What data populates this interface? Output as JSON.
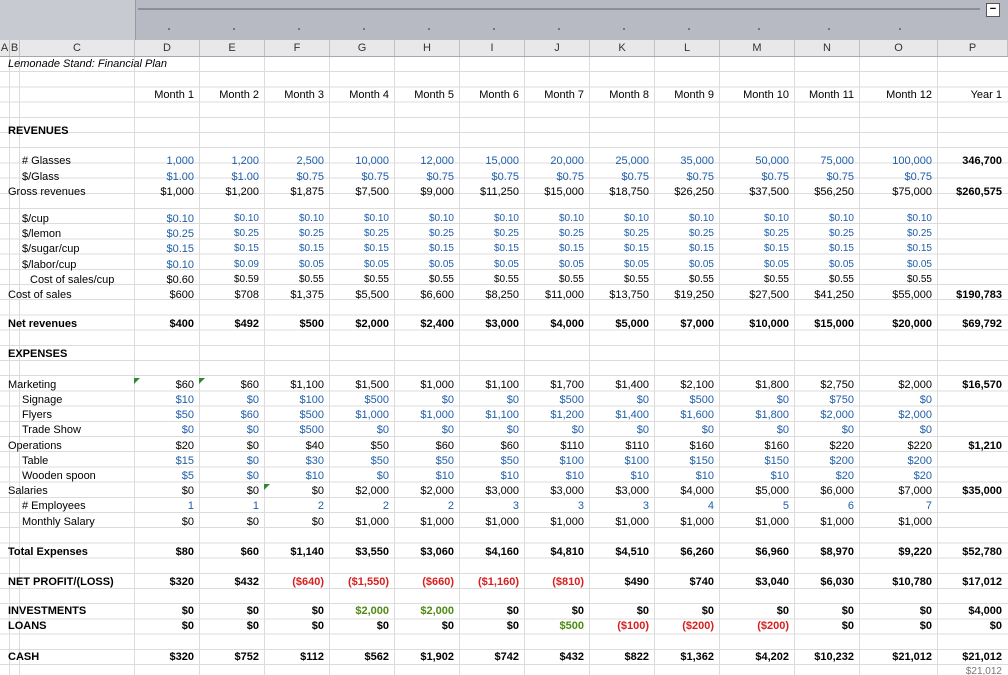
{
  "colors": {
    "input": "#1f5ea8",
    "negative": "#d62020",
    "green": "#4f8a10"
  },
  "columns": [
    "A",
    "B",
    "C",
    "D",
    "E",
    "F",
    "G",
    "H",
    "I",
    "J",
    "K",
    "L",
    "M",
    "N",
    "O",
    "P"
  ],
  "title": "Lemonade Stand: Financial Plan",
  "header": [
    "Month 1",
    "Month 2",
    "Month 3",
    "Month 4",
    "Month 5",
    "Month 6",
    "Month 7",
    "Month 8",
    "Month 9",
    "Month 10",
    "Month 11",
    "Month 12",
    "Year 1"
  ],
  "rows": [
    {
      "y": 4.6,
      "label": "REVENUES",
      "x": 0,
      "bold": true
    },
    {
      "y": 6.6,
      "label": "# Glasses",
      "x": 1,
      "color": "blue",
      "vals": [
        "1,000",
        "1,200",
        "2,500",
        "10,000",
        "12,000",
        "15,000",
        "20,000",
        "25,000",
        "35,000",
        "50,000",
        "75,000",
        "100,000"
      ],
      "total": "346,700"
    },
    {
      "y": 7.6,
      "label": "$/Glass",
      "x": 1,
      "color": "blue",
      "vals": [
        "$1.00",
        "$1.00",
        "$0.75",
        "$0.75",
        "$0.75",
        "$0.75",
        "$0.75",
        "$0.75",
        "$0.75",
        "$0.75",
        "$0.75",
        "$0.75"
      ]
    },
    {
      "y": 8.6,
      "label": "Gross revenues",
      "x": 0,
      "vals": [
        "$1,000",
        "$1,200",
        "$1,875",
        "$7,500",
        "$9,000",
        "$11,250",
        "$15,000",
        "$18,750",
        "$26,250",
        "$37,500",
        "$56,250",
        "$75,000"
      ],
      "total": "$260,575"
    },
    {
      "y": 10.4,
      "label": "$/cup",
      "x": 1,
      "color": "blue",
      "small": true,
      "vals": [
        "$0.10",
        "$0.10",
        "$0.10",
        "$0.10",
        "$0.10",
        "$0.10",
        "$0.10",
        "$0.10",
        "$0.10",
        "$0.10",
        "$0.10",
        "$0.10"
      ]
    },
    {
      "y": 11.4,
      "label": "$/lemon",
      "x": 1,
      "color": "blue",
      "small": true,
      "vals": [
        "$0.25",
        "$0.25",
        "$0.25",
        "$0.25",
        "$0.25",
        "$0.25",
        "$0.25",
        "$0.25",
        "$0.25",
        "$0.25",
        "$0.25",
        "$0.25"
      ]
    },
    {
      "y": 12.4,
      "label": "$/sugar/cup",
      "x": 1,
      "color": "blue",
      "small": true,
      "vals": [
        "$0.15",
        "$0.15",
        "$0.15",
        "$0.15",
        "$0.15",
        "$0.15",
        "$0.15",
        "$0.15",
        "$0.15",
        "$0.15",
        "$0.15",
        "$0.15"
      ]
    },
    {
      "y": 13.4,
      "label": "$/labor/cup",
      "x": 1,
      "color": "blue",
      "small": true,
      "vals": [
        "$0.10",
        "$0.09",
        "$0.05",
        "$0.05",
        "$0.05",
        "$0.05",
        "$0.05",
        "$0.05",
        "$0.05",
        "$0.05",
        "$0.05",
        "$0.05"
      ]
    },
    {
      "y": 14.4,
      "label": "Cost of sales/cup",
      "x": 2,
      "small": true,
      "vals": [
        "$0.60",
        "$0.59",
        "$0.55",
        "$0.55",
        "$0.55",
        "$0.55",
        "$0.55",
        "$0.55",
        "$0.55",
        "$0.55",
        "$0.55",
        "$0.55"
      ]
    },
    {
      "y": 15.4,
      "label": "Cost of sales",
      "x": 0,
      "vals": [
        "$600",
        "$708",
        "$1,375",
        "$5,500",
        "$6,600",
        "$8,250",
        "$11,000",
        "$13,750",
        "$19,250",
        "$27,500",
        "$41,250",
        "$55,000"
      ],
      "total": "$190,783"
    },
    {
      "y": 17.3,
      "label": "Net revenues",
      "x": 0,
      "bold": true,
      "vals": [
        "$400",
        "$492",
        "$500",
        "$2,000",
        "$2,400",
        "$3,000",
        "$4,000",
        "$5,000",
        "$7,000",
        "$10,000",
        "$15,000",
        "$20,000"
      ],
      "total": "$69,792"
    },
    {
      "y": 19.3,
      "label": "EXPENSES",
      "x": 0,
      "bold": true
    },
    {
      "y": 21.3,
      "label": "Marketing",
      "x": 0,
      "vals": [
        "$60",
        "$60",
        "$1,100",
        "$1,500",
        "$1,000",
        "$1,100",
        "$1,700",
        "$1,400",
        "$2,100",
        "$1,800",
        "$2,750",
        "$2,000"
      ],
      "total": "$16,570"
    },
    {
      "y": 22.3,
      "label": "Signage",
      "x": 1,
      "color": "blue",
      "vals": [
        "$10",
        "$0",
        "$100",
        "$500",
        "$0",
        "$0",
        "$500",
        "$0",
        "$500",
        "$0",
        "$750",
        "$0"
      ]
    },
    {
      "y": 23.3,
      "label": "Flyers",
      "x": 1,
      "color": "blue",
      "vals": [
        "$50",
        "$60",
        "$500",
        "$1,000",
        "$1,000",
        "$1,100",
        "$1,200",
        "$1,400",
        "$1,600",
        "$1,800",
        "$2,000",
        "$2,000"
      ]
    },
    {
      "y": 24.3,
      "label": "Trade Show",
      "x": 1,
      "color": "blue",
      "vals": [
        "$0",
        "$0",
        "$500",
        "$0",
        "$0",
        "$0",
        "$0",
        "$0",
        "$0",
        "$0",
        "$0",
        "$0"
      ]
    },
    {
      "y": 25.3,
      "label": "Operations",
      "x": 0,
      "vals": [
        "$20",
        "$0",
        "$40",
        "$50",
        "$60",
        "$60",
        "$110",
        "$110",
        "$160",
        "$160",
        "$220",
        "$220"
      ],
      "total": "$1,210"
    },
    {
      "y": 26.3,
      "label": "Table",
      "x": 1,
      "color": "blue",
      "vals": [
        "$15",
        "$0",
        "$30",
        "$50",
        "$50",
        "$50",
        "$100",
        "$100",
        "$150",
        "$150",
        "$200",
        "$200"
      ]
    },
    {
      "y": 27.3,
      "label": "Wooden spoon",
      "x": 1,
      "color": "blue",
      "vals": [
        "$5",
        "$0",
        "$10",
        "$0",
        "$10",
        "$10",
        "$10",
        "$10",
        "$10",
        "$10",
        "$20",
        "$20"
      ]
    },
    {
      "y": 28.3,
      "label": "Salaries",
      "x": 0,
      "vals": [
        "$0",
        "$0",
        "$0",
        "$2,000",
        "$2,000",
        "$3,000",
        "$3,000",
        "$3,000",
        "$4,000",
        "$5,000",
        "$6,000",
        "$7,000"
      ],
      "total": "$35,000"
    },
    {
      "y": 29.3,
      "label": "# Employees",
      "x": 1,
      "color": "blue",
      "vals": [
        "1",
        "1",
        "2",
        "2",
        "2",
        "3",
        "3",
        "3",
        "4",
        "5",
        "6",
        "7"
      ]
    },
    {
      "y": 30.3,
      "label": "Monthly Salary",
      "x": 1,
      "vals": [
        "$0",
        "$0",
        "$0",
        "$1,000",
        "$1,000",
        "$1,000",
        "$1,000",
        "$1,000",
        "$1,000",
        "$1,000",
        "$1,000",
        "$1,000"
      ]
    },
    {
      "y": 32.3,
      "label": "Total Expenses",
      "x": 0,
      "bold": true,
      "vals": [
        "$80",
        "$60",
        "$1,140",
        "$3,550",
        "$3,060",
        "$4,160",
        "$4,810",
        "$4,510",
        "$6,260",
        "$6,960",
        "$8,970",
        "$9,220"
      ],
      "total": "$52,780"
    },
    {
      "y": 34.3,
      "label": "NET PROFIT/(LOSS)",
      "x": 0,
      "bold": true,
      "vals": [
        "$320",
        "$432",
        "($640)",
        "($1,550)",
        "($660)",
        "($1,160)",
        "($810)",
        "$490",
        "$740",
        "$3,040",
        "$6,030",
        "$10,780"
      ],
      "total": "$17,012",
      "neg": [
        2,
        3,
        4,
        5,
        6
      ]
    },
    {
      "y": 36.2,
      "label": "INVESTMENTS",
      "x": 0,
      "bold": true,
      "vals": [
        "$0",
        "$0",
        "$0",
        "$2,000",
        "$2,000",
        "$0",
        "$0",
        "$0",
        "$0",
        "$0",
        "$0",
        "$0"
      ],
      "total": "$4,000",
      "green": [
        3,
        4
      ]
    },
    {
      "y": 37.2,
      "label": "LOANS",
      "x": 0,
      "bold": true,
      "vals": [
        "$0",
        "$0",
        "$0",
        "$0",
        "$0",
        "$0",
        "$500",
        "($100)",
        "($200)",
        "($200)",
        "$0",
        "$0"
      ],
      "total": "$0",
      "green": [
        6
      ],
      "neg": [
        7,
        8,
        9
      ]
    },
    {
      "y": 39.2,
      "label": "CASH",
      "x": 0,
      "bold": true,
      "vals": [
        "$320",
        "$752",
        "$112",
        "$562",
        "$1,902",
        "$742",
        "$432",
        "$822",
        "$1,362",
        "$4,202",
        "$10,232",
        "$21,012"
      ],
      "total": "$21,012"
    },
    {
      "y": 40.2,
      "total_small": "$21,012"
    }
  ]
}
